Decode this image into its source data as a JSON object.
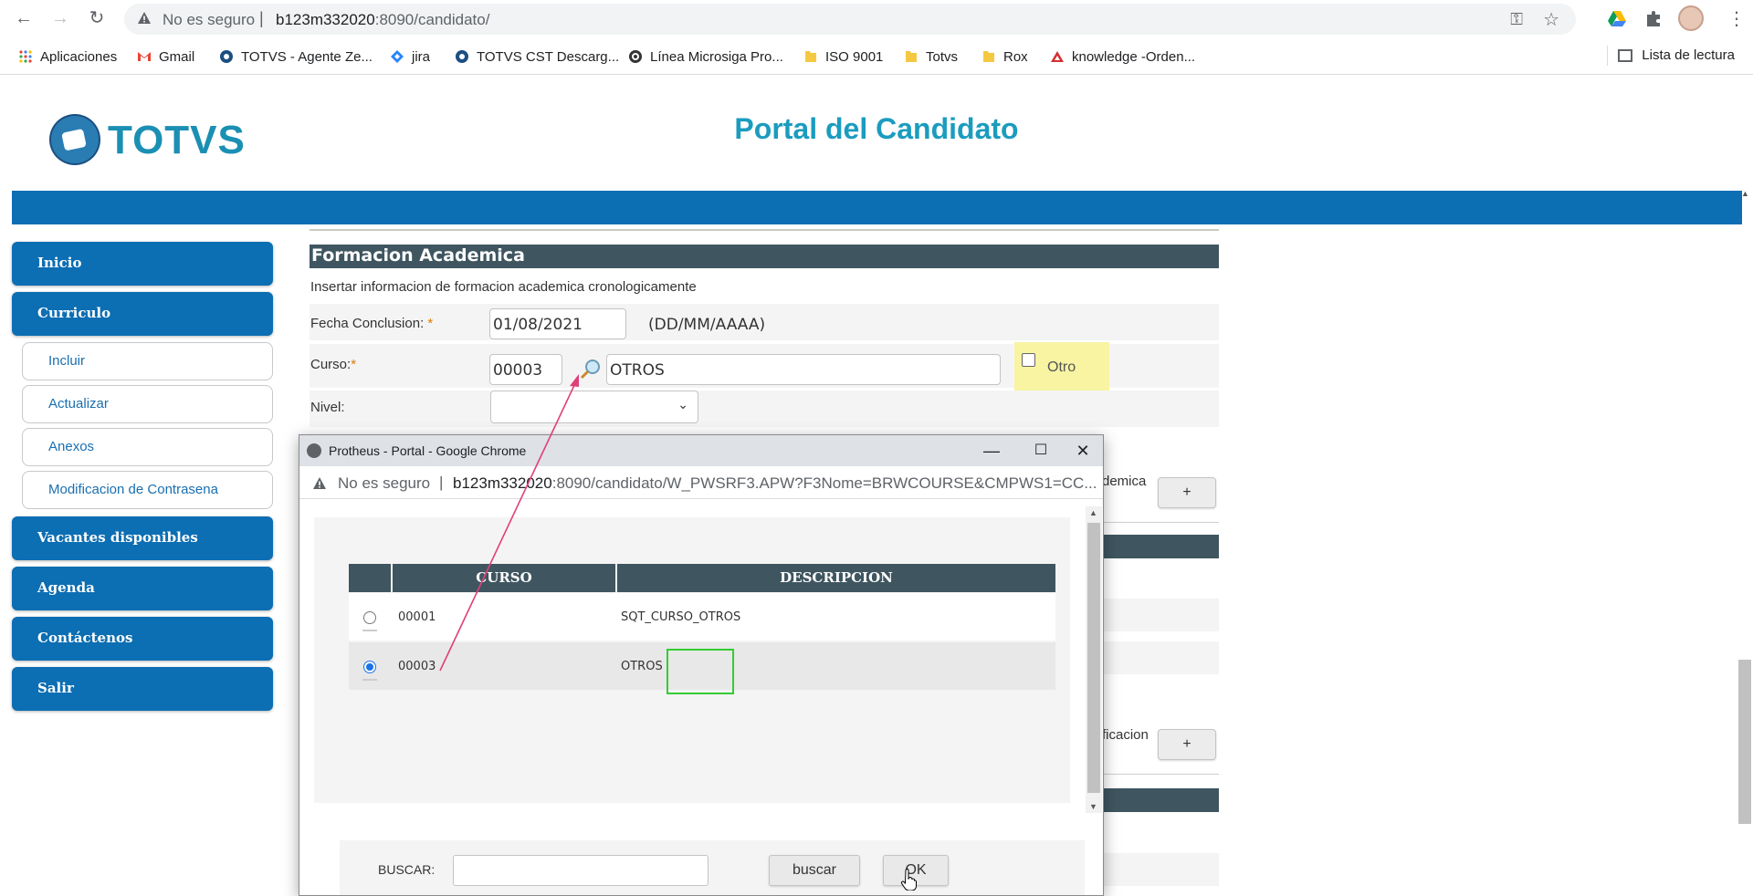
{
  "browser": {
    "address": {
      "insecure_label": "No es seguro",
      "separator": "|",
      "host": "b123m332020",
      "path": ":8090/candidato/"
    },
    "bookmarks": [
      {
        "label": "Aplicaciones",
        "icon": "apps-grid-icon"
      },
      {
        "label": "Gmail",
        "icon": "gmail-icon"
      },
      {
        "label": "TOTVS - Agente Ze...",
        "icon": "totvs-icon"
      },
      {
        "label": "jira",
        "icon": "jira-icon"
      },
      {
        "label": "TOTVS CST Descarg...",
        "icon": "totvs-icon"
      },
      {
        "label": "Línea Microsiga Pro...",
        "icon": "microsiga-icon"
      },
      {
        "label": "ISO 9001",
        "icon": "folder-icon"
      },
      {
        "label": "Totvs",
        "icon": "folder-icon"
      },
      {
        "label": "Rox",
        "icon": "folder-icon"
      },
      {
        "label": "knowledge -Orden...",
        "icon": "knowledge-icon"
      }
    ],
    "reading_list": "Lista de lectura"
  },
  "header": {
    "logo_text": "TOTVS",
    "title": "Portal del Candidato"
  },
  "sidebar": {
    "items": [
      {
        "label": "Inicio"
      },
      {
        "label": "Curriculo"
      },
      {
        "label": "Incluir"
      },
      {
        "label": "Actualizar"
      },
      {
        "label": "Anexos"
      },
      {
        "label": "Modificacion de Contrasena"
      },
      {
        "label": "Vacantes disponibles"
      },
      {
        "label": "Agenda"
      },
      {
        "label": "Contáctenos"
      },
      {
        "label": "Salir"
      }
    ]
  },
  "form": {
    "section_title": "Formacion Academica",
    "hint": "Insertar informacion de formacion academica cronologicamente",
    "fecha": {
      "label": "Fecha Conclusion:",
      "required_mark": "*",
      "value": "01/08/2021",
      "format": "(DD/MM/AAAA)"
    },
    "curso": {
      "label": "Curso:",
      "required_mark": "*",
      "code": "00003",
      "description": "OTROS"
    },
    "otro_label": "Otro",
    "nivel_label": "Nivel:",
    "clipped_label_1": "demica",
    "clipped_label_2": "ficacion",
    "plus": "+"
  },
  "popup": {
    "window_title": "Protheus - Portal - Google Chrome",
    "insecure_label": "No es seguro",
    "separator": "|",
    "url_host": "b123m332020",
    "url_rest": ":8090/candidato/W_PWSRF3.APW?F3Nome=BRWCOURSE&CMPWS1=CC...",
    "table": {
      "columns": [
        "CURSO",
        "DESCRIPCION"
      ],
      "rows": [
        {
          "curso": "00001",
          "descripcion": "SQT_CURSO_OTROS",
          "selected": false
        },
        {
          "curso": "00003",
          "descripcion": "OTROS",
          "selected": true
        }
      ]
    },
    "buscar_label": "BUSCAR:",
    "buscar_value": "",
    "buscar_button": "buscar",
    "ok_button": "OK"
  },
  "colors": {
    "brand_blue": "#0c6eb3",
    "title_cyan": "#1b9cbf",
    "section_dark": "#3f5660",
    "highlight_yellow": "#f8f4a2",
    "annotation_pink": "#e0407a",
    "annotation_green": "#33cc33"
  }
}
